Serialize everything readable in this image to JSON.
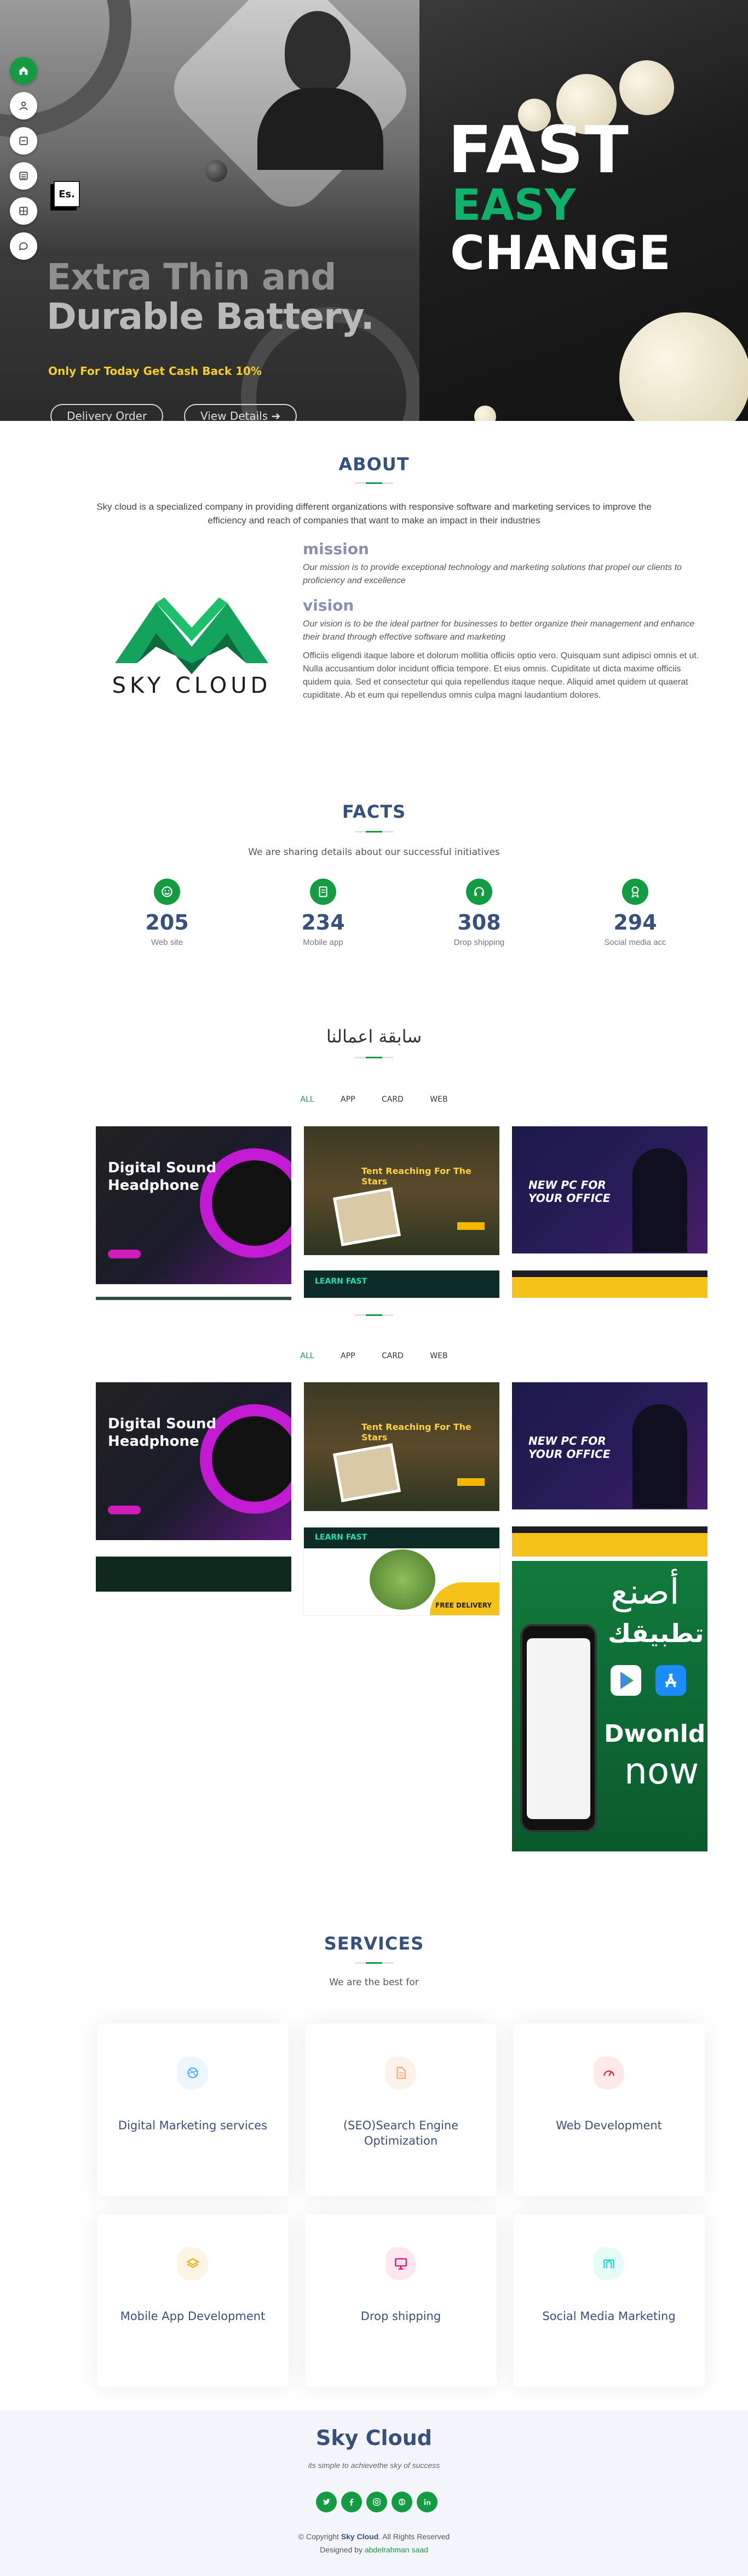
{
  "hero": {
    "title_line1": "Extra Thin and",
    "title_line2": "Durable Battery.",
    "cash_text": "Only For Today Get Cash Back 10%",
    "btn_delivery": "Delivery Order",
    "btn_view": "View Details",
    "fast": "FAST",
    "easy": "EASY",
    "change": "CHANGE",
    "accent_color": "#10b26b"
  },
  "sidenav": {
    "items": [
      "home-icon",
      "user-icon",
      "file-icon",
      "list-icon",
      "grid-icon",
      "chat-icon"
    ],
    "lang": "Es."
  },
  "about": {
    "title": "ABOUT",
    "description": "Sky cloud is a specialized company in providing different organizations with responsive software and marketing services to improve the efficiency and reach of companies that want to make an impact in their industries",
    "logo_text": "SKY CLOUD",
    "mission_title": "mission",
    "mission_text": "Our mission is to provide exceptional technology and marketing solutions that propel our clients to proficiency and excellence",
    "vision_title": "vision",
    "vision_text": "Our vision is to be the ideal partner for businesses to better organize their management and enhance their brand through effective software and marketing",
    "body_text": "Officiis eligendi itaque labore et dolorum mollitia officiis optio vero. Quisquam sunt adipisci omnis et ut. Nulla accusantium dolor incidunt officia tempore. Et eius omnis. Cupiditate ut dicta maxime officiis quidem quia. Sed et consectetur qui quia repellendus itaque neque. Aliquid amet quidem ut quaerat cupiditate. Ab et eum qui repellendus omnis culpa magni laudantium dolores."
  },
  "facts": {
    "title": "FACTS",
    "subtitle": "We are sharing details about our successful initiatives",
    "items": [
      {
        "num": "205",
        "label": "Web site",
        "icon": "smile-icon"
      },
      {
        "num": "234",
        "label": "Mobile app",
        "icon": "journal-icon"
      },
      {
        "num": "308",
        "label": "Drop shipping",
        "icon": "headset-icon"
      },
      {
        "num": "294",
        "label": "Social media acc",
        "icon": "award-icon"
      }
    ]
  },
  "portfolio": {
    "title": "سابقة اعمالنا",
    "filters": [
      "ALL",
      "APP",
      "CARD",
      "WEB"
    ],
    "tiles": {
      "headphone": "Digital Sound Headphone",
      "tent": "Tent Reaching For The Stars",
      "office": "NEW PC FOR YOUR OFFICE",
      "learn": "LEARN FAST",
      "free_delivery": "FREE DELIVERY",
      "app_ar1": "أصنع",
      "app_ar2": "تطبيقك",
      "app_download": "Dwonld",
      "app_now": "now"
    }
  },
  "services": {
    "title": "SERVICES",
    "subtitle": "We are the best for",
    "items": [
      {
        "title": "Digital Marketing services",
        "icon": "dribbble-icon",
        "color": "#47aeff",
        "bg": "#eef6fd"
      },
      {
        "title": "(SEO)Search Engine Optimization",
        "icon": "file-text-icon",
        "color": "#ffa76e",
        "bg": "#fdf2ea"
      },
      {
        "title": "Web Development",
        "icon": "speedometer-icon",
        "color": "#e9222c",
        "bg": "#fde9ea"
      },
      {
        "title": "Mobile App Development",
        "icon": "layers-icon",
        "color": "#ffa510",
        "bg": "#fdf4e4"
      },
      {
        "title": "Drop shipping",
        "icon": "slideshow-icon",
        "color": "#e80368",
        "bg": "#fde6ef"
      },
      {
        "title": "Social Media Marketing",
        "icon": "arch-icon",
        "color": "#11dbcf",
        "bg": "#e6faf8"
      }
    ]
  },
  "footer": {
    "title": "Sky Cloud",
    "tagline": "its simple to achievethe sky of success",
    "socials": [
      "twitter-icon",
      "facebook-icon",
      "instagram-icon",
      "skype-icon",
      "linkedin-icon"
    ],
    "copy_prefix": "© Copyright",
    "copy_brand": "Sky Cloud",
    "copy_suffix": ". All Rights Reserved",
    "designed_by": "Designed by",
    "designer": "abdelrahman saad"
  }
}
